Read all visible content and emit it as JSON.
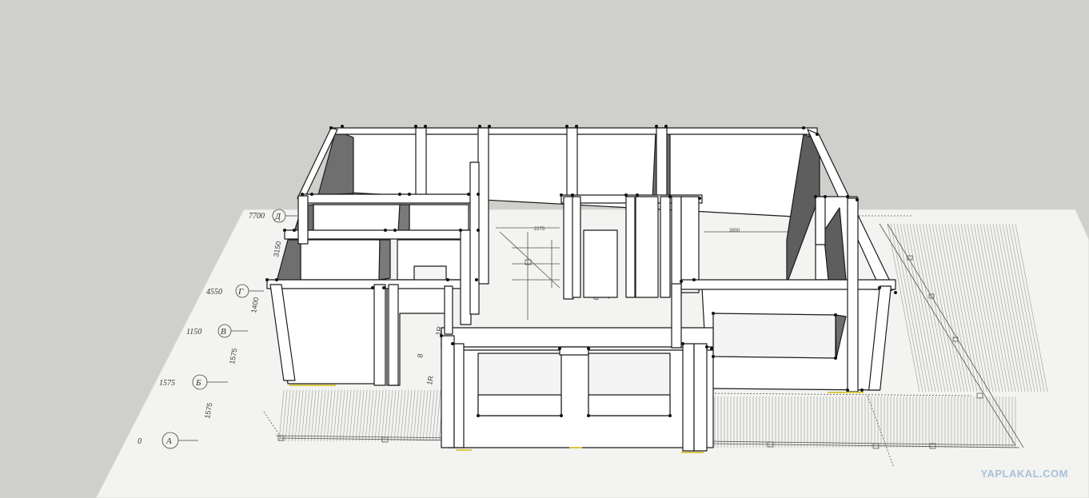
{
  "scene": {
    "background_color": "#cfcfcb",
    "plan_color": "#f3f3f1",
    "wall_face_color": "#ffffff",
    "wall_shadow_color": "#6b6b6b",
    "edge_color": "#1a1a1a"
  },
  "plan_labels": {
    "levels": [
      "7700",
      "4550",
      "1150",
      "1575",
      "0"
    ],
    "axes": [
      "Д",
      "Г",
      "В",
      "Б",
      "А"
    ],
    "dimensions": [
      "3150",
      "1400",
      "1575",
      "1575",
      "2275",
      "3800",
      "87",
      "20"
    ],
    "room_marks": [
      "1R",
      "1R",
      "8"
    ]
  },
  "watermark": "YAPLAKAL.COM"
}
